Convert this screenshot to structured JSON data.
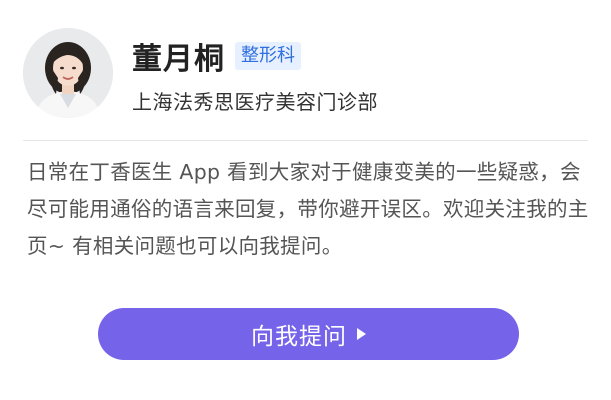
{
  "doctor": {
    "name": "董月桐",
    "department": "整形科",
    "hospital": "上海法秀思医疗美容门诊部",
    "avatar_icon": "doctor-portrait-icon"
  },
  "intro": {
    "text": "日常在丁香医生 App 看到大家对于健康变美的一些疑惑，会尽可能用通俗的语言来回复，带你避开误区。欢迎关注我的主页~ 有相关问题也可以向我提问。"
  },
  "actions": {
    "ask_label": "向我提问",
    "ask_icon": "play-arrow-icon"
  },
  "colors": {
    "accent": "#7563ea",
    "badge_bg": "#e6f0ff",
    "badge_text": "#2f6fe0"
  }
}
